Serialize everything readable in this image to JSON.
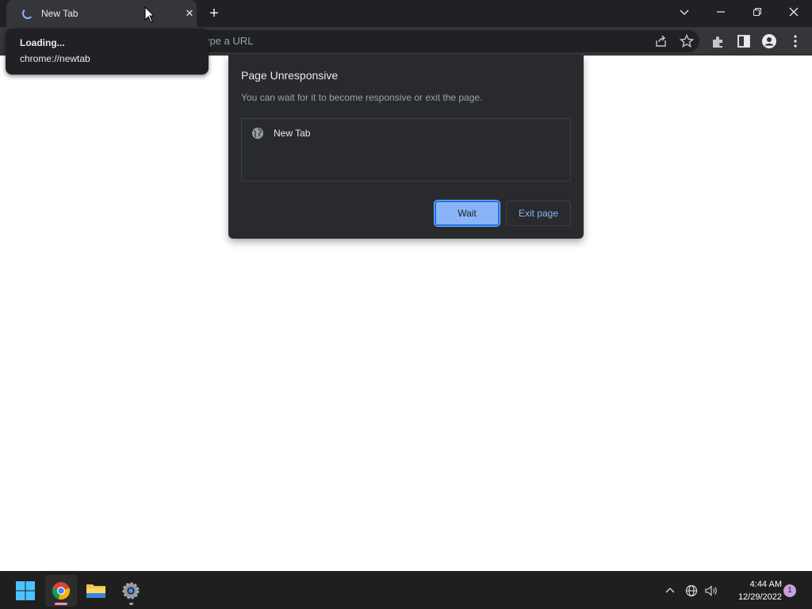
{
  "tab": {
    "title": "New Tab",
    "close": "✕"
  },
  "new_tab_button": "+",
  "window_controls": {
    "tab_search": "⌄",
    "minimize": "—",
    "restore": "❐",
    "close": "✕"
  },
  "omnibox": {
    "visible_text": "ype a URL"
  },
  "hover_card": {
    "title": "Loading...",
    "url": "chrome://newtab"
  },
  "dialog": {
    "title": "Page Unresponsive",
    "description": "You can wait for it to become responsive or exit the page.",
    "pages": [
      {
        "label": "New Tab",
        "icon": "globe-icon"
      }
    ],
    "wait_label": "Wait",
    "exit_label": "Exit page"
  },
  "taskbar": {
    "apps": [
      "start-icon",
      "chrome-icon",
      "file-explorer-icon",
      "settings-icon"
    ],
    "clock": {
      "time": "4:44 AM",
      "date": "12/29/2022"
    },
    "notification_count": "1"
  },
  "colors": {
    "accent": "#8ab4f8",
    "frame": "#202124",
    "toolbar": "#35363a",
    "dialog": "#292a2d"
  }
}
